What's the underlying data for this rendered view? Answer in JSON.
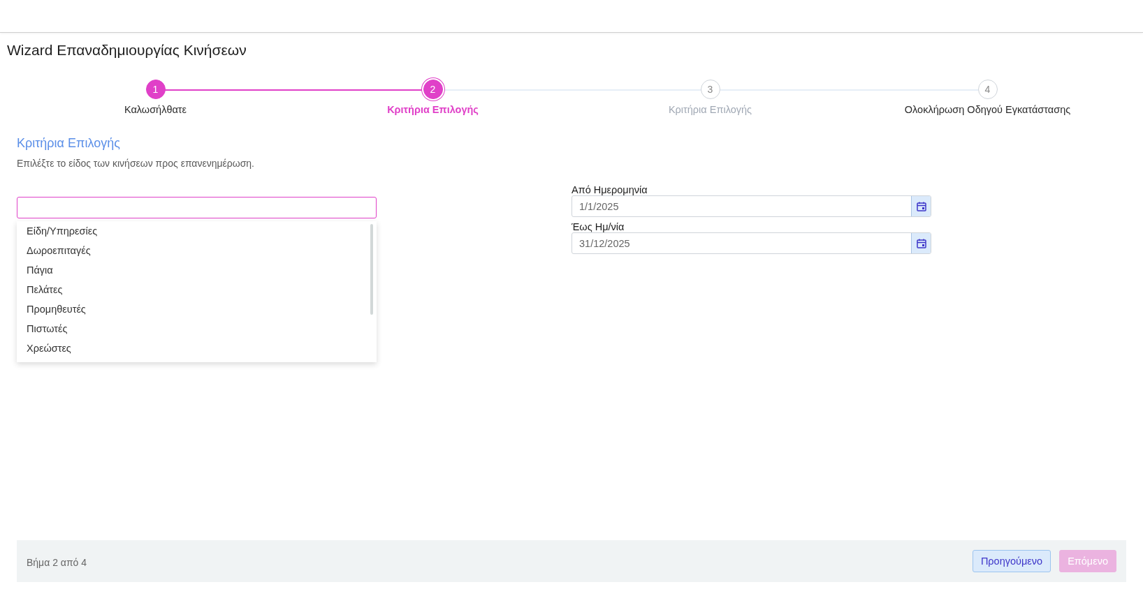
{
  "page": {
    "title": "Wizard Επαναδημιουργίας Κινήσεων"
  },
  "steps": [
    {
      "number": "1",
      "label": "Καλωσήλθατε",
      "kind": "done"
    },
    {
      "number": "2",
      "label": "Κριτήρια Επιλογής",
      "kind": "current"
    },
    {
      "number": "3",
      "label": "Κριτήρια Επιλογής",
      "kind": "disabled"
    },
    {
      "number": "4",
      "label": "Ολοκλήρωση Οδηγού Εγκατάστασης",
      "kind": "upcoming"
    }
  ],
  "section": {
    "heading": "Κριτήρια Επιλογής",
    "description": "Επιλέξτε το είδος των κινήσεων προς επανενημέρωση."
  },
  "type_select": {
    "expanded": true,
    "options": [
      {
        "label": "Είδη/Υπηρεσίες"
      },
      {
        "label": "Δωροεπιταγές"
      },
      {
        "label": "Πάγια"
      },
      {
        "label": "Πελάτες"
      },
      {
        "label": "Προμηθευτές"
      },
      {
        "label": "Πιστωτές"
      },
      {
        "label": "Χρεώστες"
      }
    ]
  },
  "date_fields": [
    {
      "label": "Από Ημερομηνία",
      "value": "1/1/2025"
    },
    {
      "label": "Έως Ημ/νία",
      "value": "31/12/2025"
    }
  ],
  "footer": {
    "step_text": "Βήμα 2 από 4",
    "buttons": [
      {
        "label": "Προηγούμενο",
        "kind": "secondary",
        "disabled": false
      },
      {
        "label": "Επόμενο",
        "kind": "primary",
        "disabled": true
      }
    ]
  }
}
